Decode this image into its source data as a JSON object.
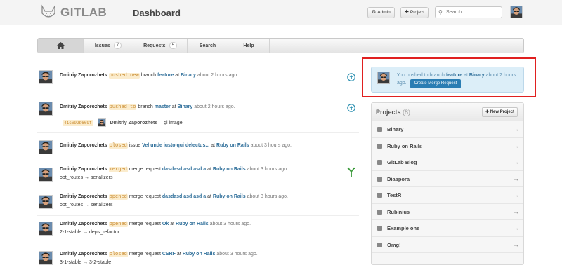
{
  "header": {
    "logo_text": "GITLAB",
    "title": "Dashboard",
    "admin_label": "Admin",
    "project_label": "Project",
    "search_placeholder": "Search",
    "icons": {
      "logo": "fox-logo-icon",
      "admin": "gear-icon",
      "project": "plus-icon",
      "search": "search-icon"
    }
  },
  "nav": {
    "home_icon": "home-icon",
    "issues_label": "Issues",
    "issues_count": "7",
    "requests_label": "Requests",
    "requests_count": "5",
    "search_label": "Search",
    "help_label": "Help"
  },
  "events": [
    {
      "author": "Dmitriy Zaporozhets",
      "action": "pushed new",
      "pre": "branch",
      "target": "feature",
      "mid": "at",
      "project": "Binary",
      "time": "about 2 hours ago.",
      "icon": "push-icon"
    },
    {
      "author": "Dmitriy Zaporozhets",
      "action": "pushed to",
      "pre": "branch",
      "target": "master",
      "mid": "at",
      "project": "Binary",
      "time": "about 2 hours ago.",
      "icon": "push-icon",
      "commit": {
        "id": "41c692b669f",
        "author": "Dmitriy Zaporozhets",
        "message": "– gi image"
      }
    },
    {
      "author": "Dmitriy Zaporozhets",
      "action": "closed",
      "pre": "issue",
      "target": "Vel unde iusto qui delectus...",
      "mid": "at",
      "project": "Ruby on Rails",
      "time": "about 3 hours ago."
    },
    {
      "author": "Dmitriy Zaporozhets",
      "action": "merged",
      "pre": "merge request",
      "target": "dasdasd asd asd a",
      "mid": "at",
      "project": "Ruby on Rails",
      "time": "about 3 hours ago.",
      "branch": "opt_routes → serializers",
      "icon": "merge-icon"
    },
    {
      "author": "Dmitriy Zaporozhets",
      "action": "opened",
      "pre": "merge request",
      "target": "dasdasd asd asd a",
      "mid": "at",
      "project": "Ruby on Rails",
      "time": "about 3 hours ago.",
      "branch": "opt_routes → serializers"
    },
    {
      "author": "Dmitriy Zaporozhets",
      "action": "opened",
      "pre": "merge request",
      "target": "Ok",
      "mid": "at",
      "project": "Ruby on Rails",
      "time": "about 3 hours ago.",
      "branch": "2-1-stable → deps_refactor"
    },
    {
      "author": "Dmitriy Zaporozhets",
      "action": "closed",
      "pre": "merge request",
      "target": "CSRF",
      "mid": "at",
      "project": "Ruby on Rails",
      "time": "about 3 hours ago.",
      "branch": "3-1-stable → 3-2-stable"
    }
  ],
  "notice": {
    "prefix": "You pushed to branch",
    "branch": "feature",
    "mid": "at",
    "project": "Binary",
    "time": "about 2 hours ago.",
    "button": "Create Merge Request"
  },
  "projects": {
    "title": "Projects",
    "count": "(8)",
    "new_label": "New Project",
    "items": [
      "Binary",
      "Ruby on Rails",
      "GitLab Blog",
      "Diaspora",
      "TestR",
      "Rubinius",
      "Example one",
      "Omg!"
    ]
  },
  "colors": {
    "link": "#2f6f9a",
    "action_bg": "#fbeccd",
    "action_text": "#c98b2f",
    "notice_bg": "#dceef8",
    "button_blue": "#2a7db3",
    "highlight": "#e02020",
    "merge_green": "#3a9a3a",
    "push_teal": "#2a8fb0"
  }
}
